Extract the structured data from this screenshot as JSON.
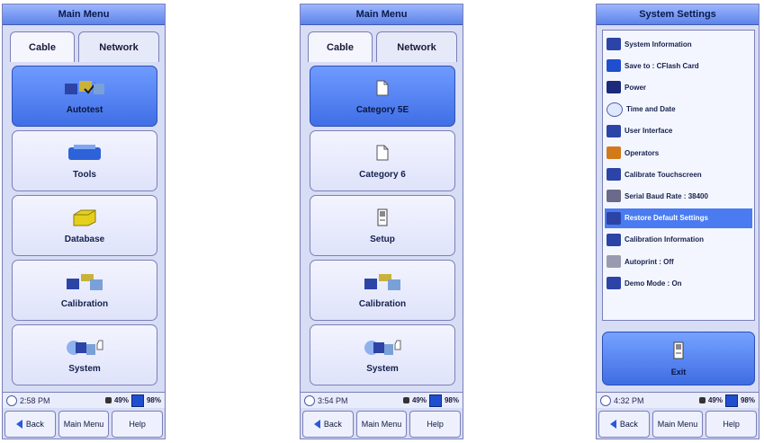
{
  "panel1": {
    "title": "Main Menu",
    "tabs": [
      "Cable",
      "Network"
    ],
    "items": [
      {
        "label": "Autotest",
        "icon": "autotest-icon",
        "selected": true
      },
      {
        "label": "Tools",
        "icon": "tools-icon",
        "selected": false
      },
      {
        "label": "Database",
        "icon": "database-icon",
        "selected": false
      },
      {
        "label": "Calibration",
        "icon": "calibration-icon",
        "selected": false
      },
      {
        "label": "System",
        "icon": "system-icon",
        "selected": false
      }
    ],
    "status": {
      "time": "2:58 PM",
      "lock_pct": "49%",
      "battery_pct": "98%"
    }
  },
  "panel2": {
    "title": "Main Menu",
    "tabs": [
      "Cable",
      "Network"
    ],
    "items": [
      {
        "label": "Category 5E",
        "icon": "document-icon",
        "selected": true
      },
      {
        "label": "Category 6",
        "icon": "document-icon",
        "selected": false
      },
      {
        "label": "Setup",
        "icon": "setup-icon",
        "selected": false
      },
      {
        "label": "Calibration",
        "icon": "calibration-icon",
        "selected": false
      },
      {
        "label": "System",
        "icon": "system-icon",
        "selected": false
      }
    ],
    "status": {
      "time": "3:54 PM",
      "lock_pct": "49%",
      "battery_pct": "98%"
    }
  },
  "panel3": {
    "title": "System Settings",
    "list": [
      {
        "label": "System Information",
        "icon": "pda-icon"
      },
      {
        "label": "Save to : CFlash Card",
        "icon": "floppy-icon"
      },
      {
        "label": "Power",
        "icon": "battery-icon"
      },
      {
        "label": "Time and Date",
        "icon": "clock-icon"
      },
      {
        "label": "User Interface",
        "icon": "pda-icon"
      },
      {
        "label": "Operators",
        "icon": "user-icon"
      },
      {
        "label": "Calibrate Touchscreen",
        "icon": "pda-icon"
      },
      {
        "label": "Serial Baud Rate : 38400",
        "icon": "serial-icon"
      },
      {
        "label": "Restore Default Settings",
        "icon": "pda-icon"
      },
      {
        "label": "Calibration Information",
        "icon": "pda-icon"
      },
      {
        "label": "Autoprint : Off",
        "icon": "printer-icon"
      },
      {
        "label": "Demo Mode : On",
        "icon": "pda-icon"
      }
    ],
    "selected_index": 8,
    "exit_label": "Exit",
    "status": {
      "time": "4:32 PM",
      "lock_pct": "49%",
      "battery_pct": "98%"
    }
  },
  "buttons": {
    "back": "Back",
    "main_menu": "Main Menu",
    "help": "Help"
  },
  "colors": {
    "accent": "#4a7bf0",
    "panel_bg": "#d8ddf6",
    "title_bg": "#5b83e8"
  }
}
